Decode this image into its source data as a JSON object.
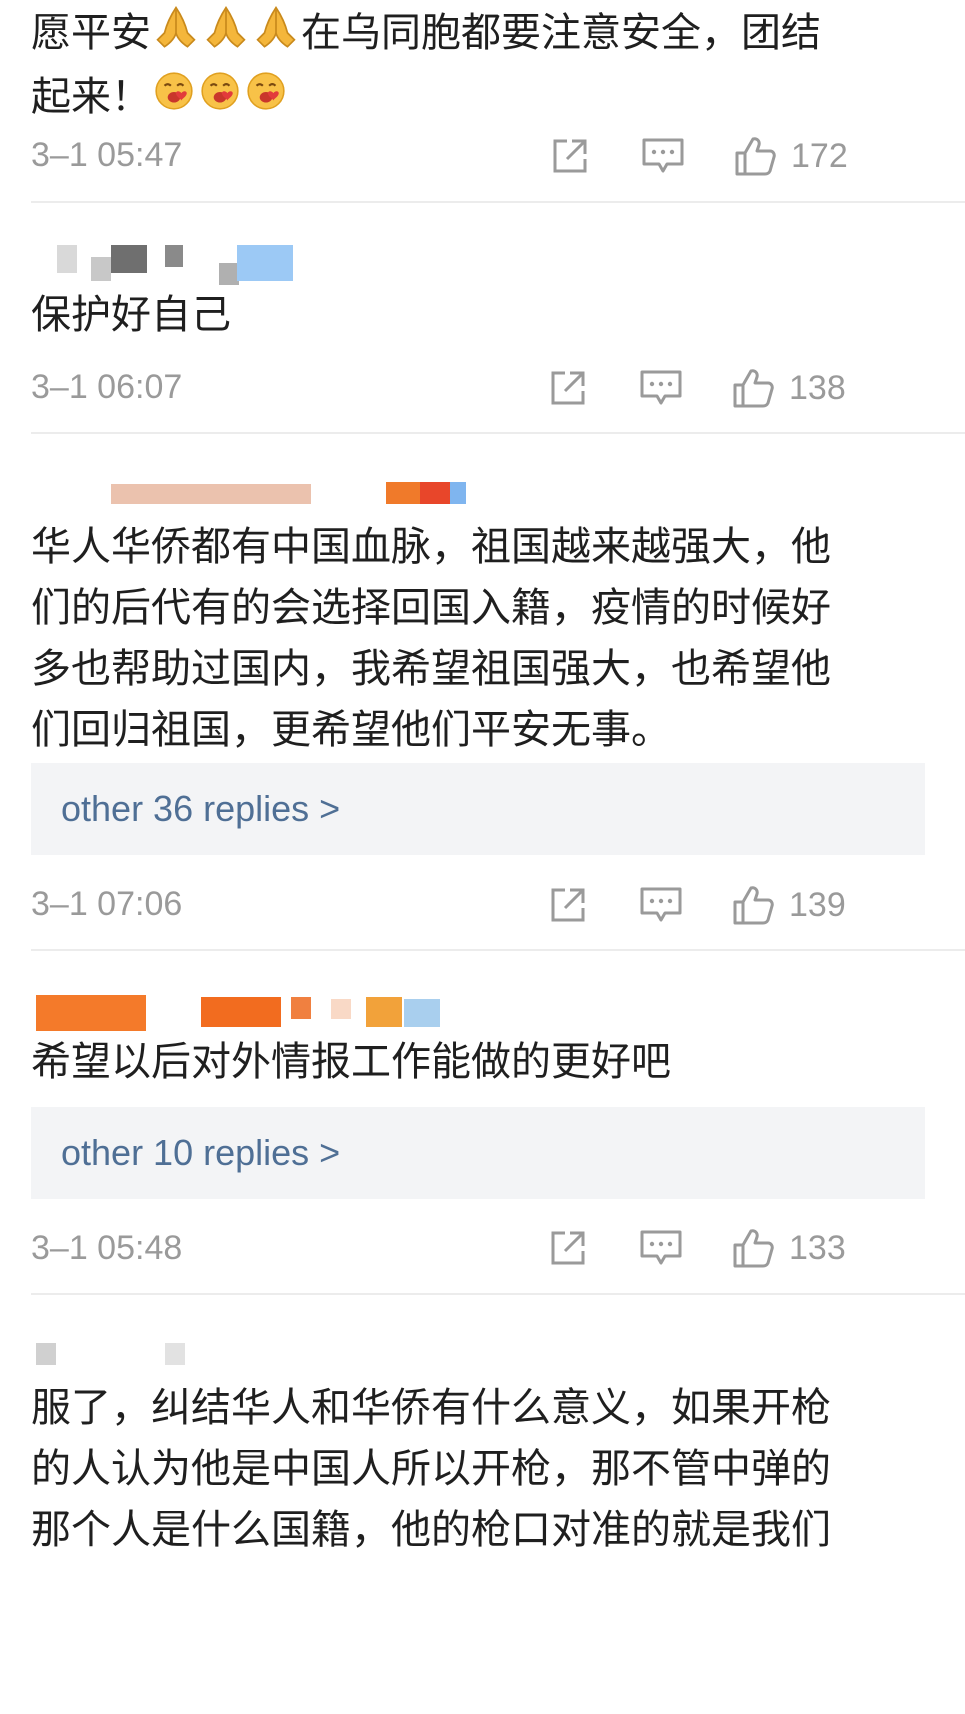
{
  "comments": [
    {
      "text_a": "愿平安",
      "text_b": "在乌同胞都要注意安全，团结",
      "text_c": "起来！",
      "emoji_pray": "pray-emoji",
      "emoji_face": "blowing-kiss-emoji",
      "time": "3–1 05:47",
      "likes": "172"
    },
    {
      "text": "保护好自己",
      "time": "3–1 06:07",
      "likes": "138"
    },
    {
      "text": "华人华侨都有中国血脉，祖国越来越强大，他们的后代有的会选择回国入籍，疫情的时候好多也帮助过国内，我希望祖国强大，也希望他们回归祖国，更希望他们平安无事。",
      "replies": "other 36 replies >",
      "time": "3–1 07:06",
      "likes": "139"
    },
    {
      "text": "希望以后对外情报工作能做的更好吧",
      "replies": "other 10 replies >",
      "time": "3–1 05:48",
      "likes": "133"
    },
    {
      "text": "服了，纠结华人和华侨有什么意义，如果开枪的人认为他是中国人所以开枪，那不管中弹的那个人是什么国籍，他的枪口对准的就是我们"
    }
  ],
  "icons": {
    "share": "share-icon",
    "comment": "comment-icon",
    "like": "thumbs-up-icon"
  },
  "colors": {
    "reply_link": "#4f6f95",
    "meta_gray": "#9a9a9a",
    "reply_bg": "#f3f4f6"
  }
}
